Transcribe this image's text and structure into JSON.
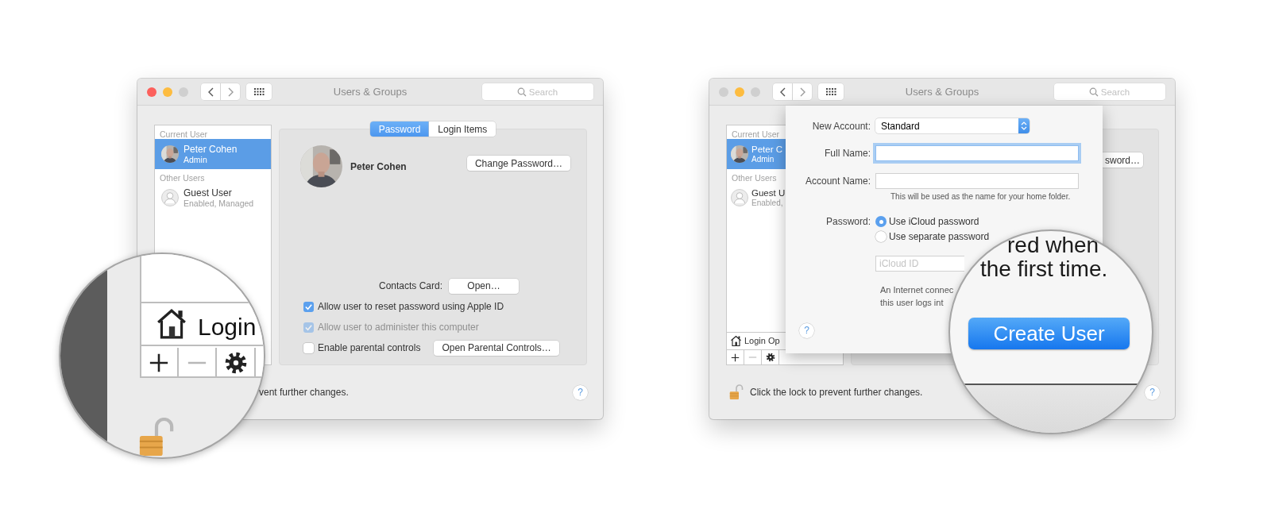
{
  "first_window": {
    "title": "Users & Groups",
    "dimmed": false,
    "search": {
      "placeholder": "Search"
    },
    "sidebar": [
      {
        "header": "Current User",
        "users": [
          {
            "name": "Peter Cohen",
            "role": "Admin",
            "selected": true
          }
        ]
      },
      {
        "header": "Other Users",
        "users": [
          {
            "name": "Guest User",
            "role": "Enabled, Managed",
            "selected": false,
            "kind": "generic"
          }
        ]
      }
    ],
    "tabs": [
      {
        "label": "Password",
        "selected": true
      },
      {
        "label": "Login Items",
        "selected": false
      }
    ],
    "user_name": "Peter Cohen",
    "change_password_button": "Change Password…",
    "contacts_label": "Contacts Card:",
    "contacts_button": "Open…",
    "options": [
      {
        "label": "Allow user to reset password using Apple ID",
        "checked": true,
        "disabled": false
      },
      {
        "label": "Allow user to administer this computer",
        "checked": true,
        "disabled": true
      },
      {
        "label": "Enable parental controls",
        "checked": false,
        "disabled": false,
        "button": "Open Parental Controls…"
      }
    ],
    "lock_text": "vent further changes.",
    "help": "?"
  },
  "second_window": {
    "title": "Users & Groups",
    "dimmed": true,
    "search": {
      "placeholder": "Search"
    },
    "sidebar": [
      {
        "header": "Current User",
        "users": [
          {
            "name": "Peter C",
            "role": "Admin",
            "selected": true
          }
        ]
      },
      {
        "header": "Other Users",
        "users": [
          {
            "name": "Guest U",
            "role": "Enabled,",
            "selected": false,
            "kind": "generic"
          }
        ]
      }
    ],
    "panel_button": "sword…",
    "footer_label": "Login Op",
    "lock_text": "Click the lock to prevent further changes.",
    "help": "?",
    "sheet": {
      "fields": [
        {
          "kind": "popup",
          "label": "New Account:",
          "value": "Standard"
        },
        {
          "kind": "text",
          "label": "Full Name:",
          "focused": true
        },
        {
          "kind": "text",
          "label": "Account Name:",
          "focused": false,
          "hint": "This will be used as the name for your home folder."
        },
        {
          "kind": "radios",
          "label": "Password:",
          "options": [
            {
              "label": "Use iCloud password",
              "selected": true
            },
            {
              "label": "Use separate password",
              "selected": false
            }
          ]
        },
        {
          "kind": "id_field",
          "placeholder": "iCloud ID"
        },
        {
          "kind": "note",
          "lines": [
            "An Internet connec",
            "this user logs int"
          ]
        }
      ],
      "help": "?"
    }
  },
  "magnifiers": [
    {
      "kind": "sidebar_footer",
      "label": "Login"
    },
    {
      "kind": "sheet_button",
      "lines": [
        "red when",
        "the first time."
      ],
      "button": "Create User"
    }
  ]
}
